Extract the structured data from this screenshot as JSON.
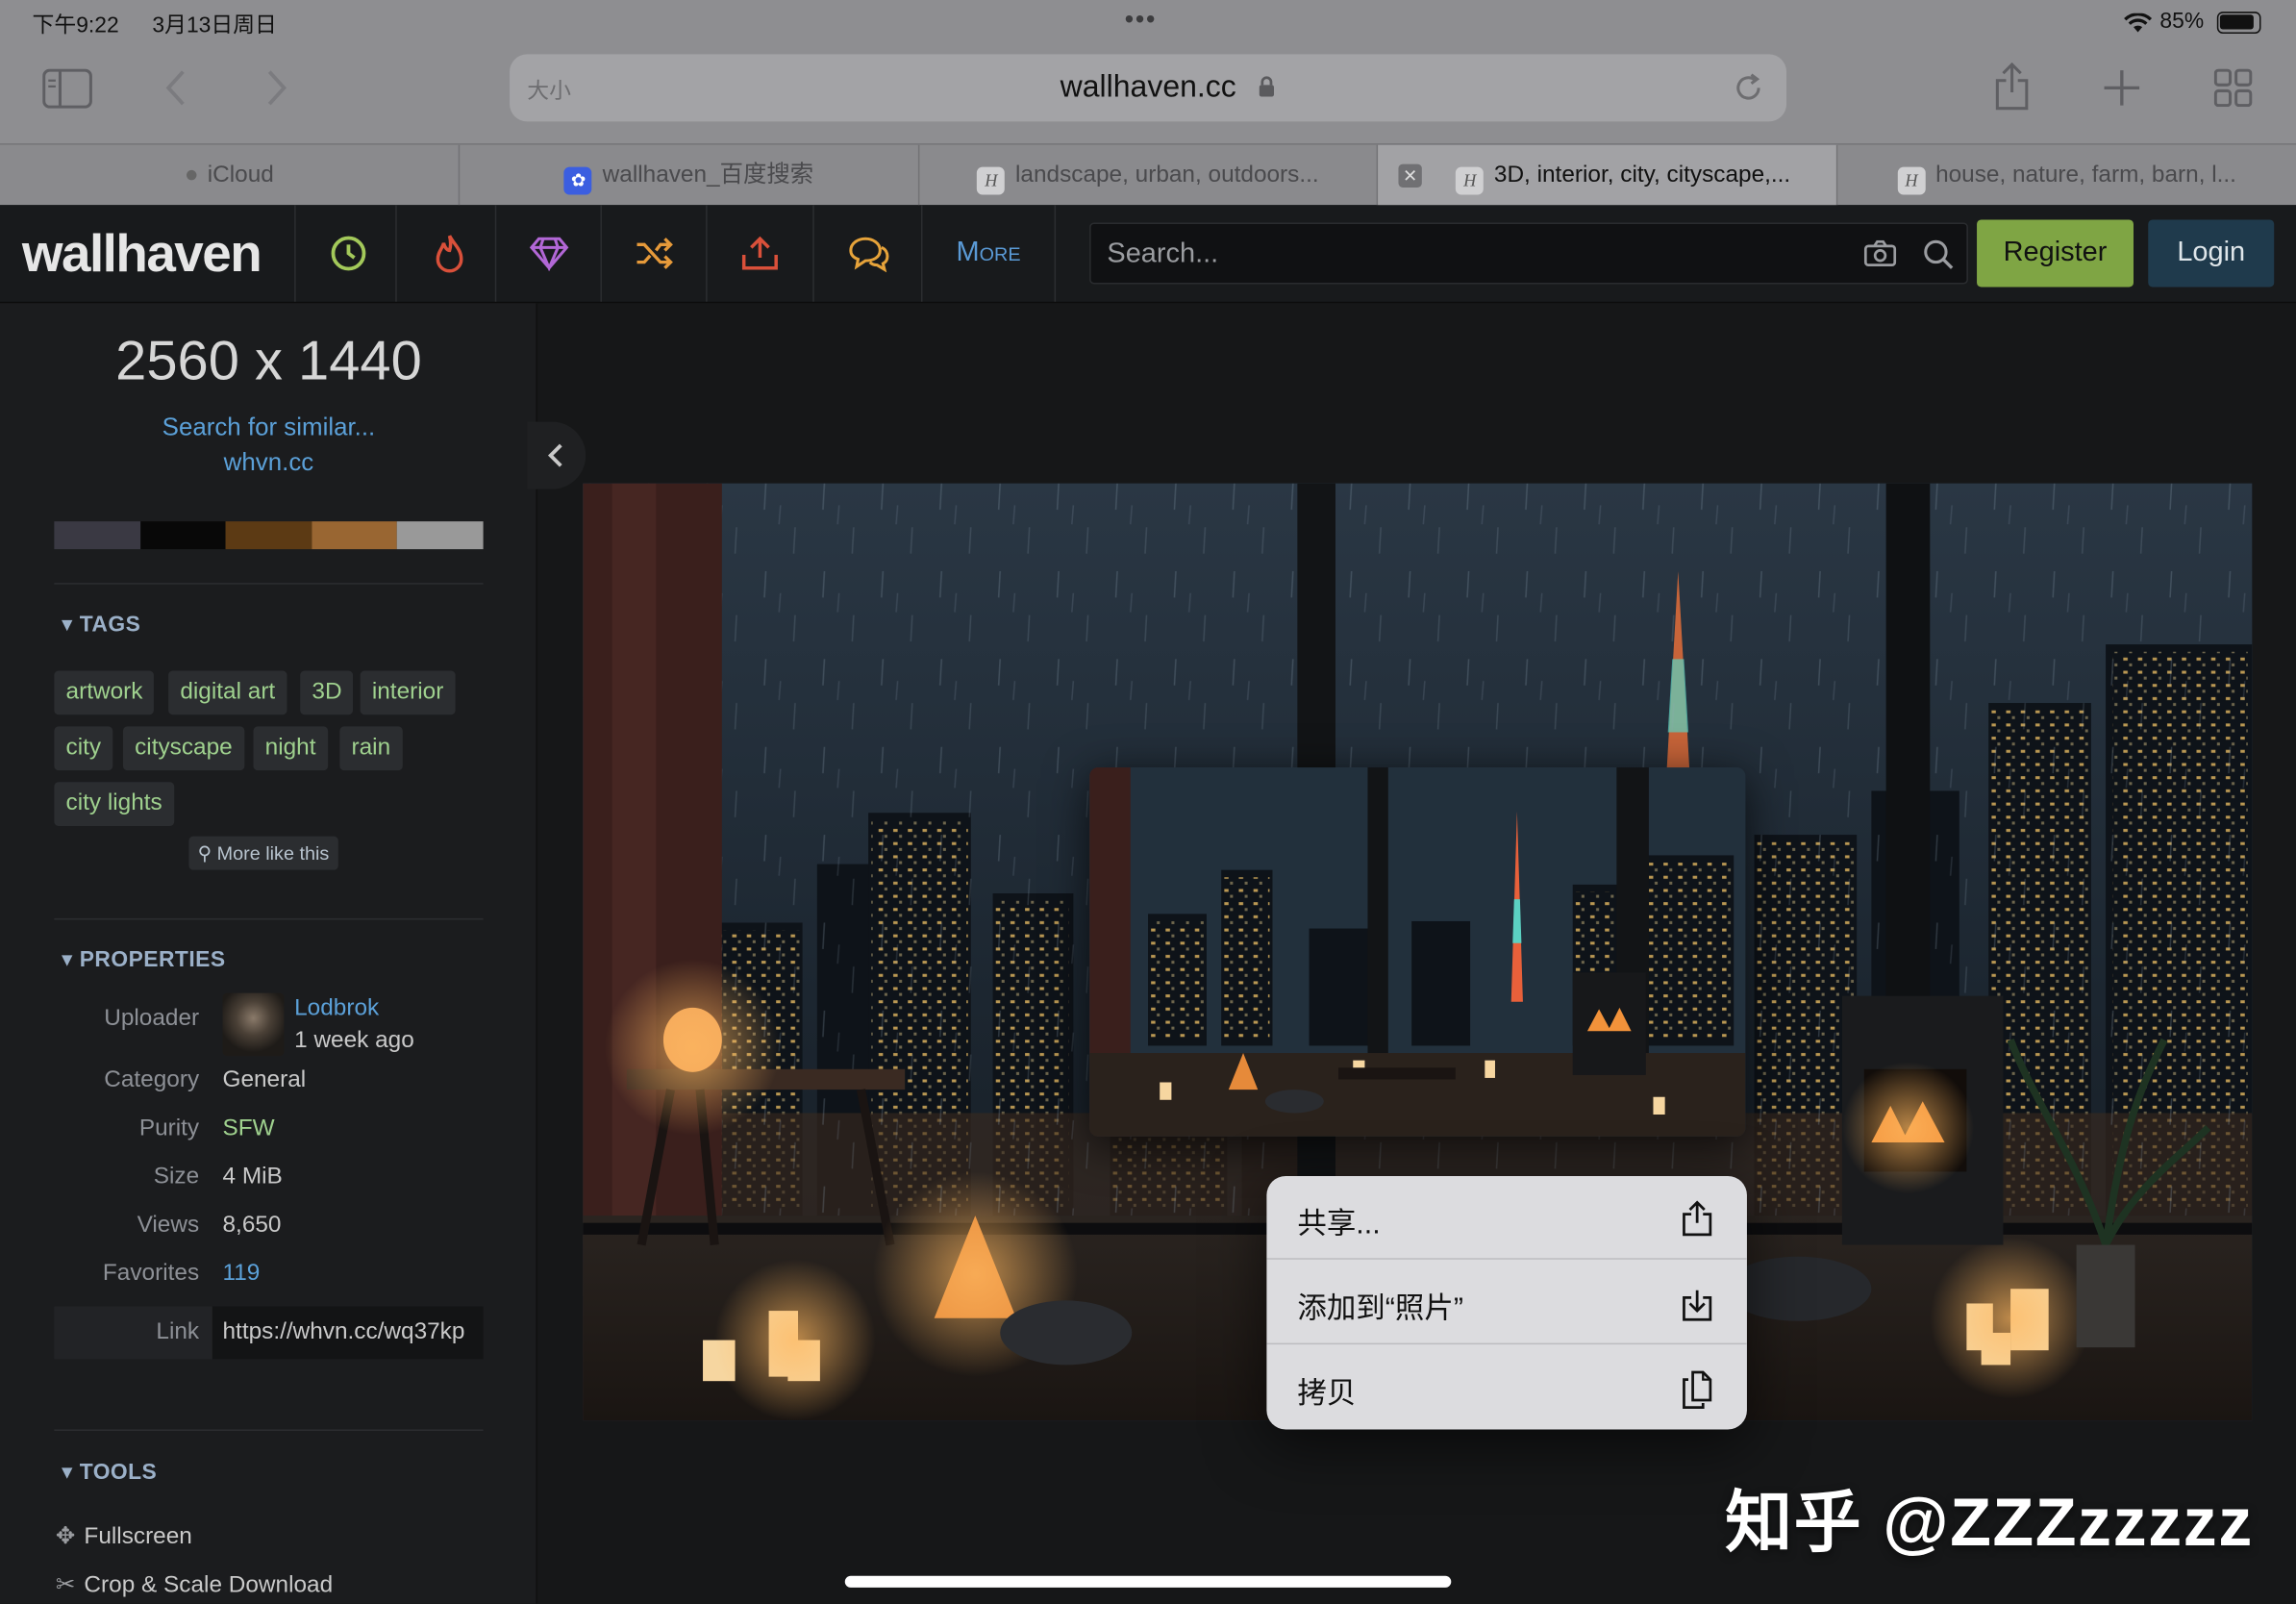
{
  "status": {
    "time": "下午9:22",
    "date": "3月13日周日",
    "battery": "85%",
    "dots": "•••"
  },
  "safari": {
    "url": "wallhaven.cc",
    "text_size": "大小"
  },
  "tabs": [
    {
      "label": "iCloud"
    },
    {
      "label": "wallhaven_百度搜索"
    },
    {
      "label": "landscape, urban, outdoors..."
    },
    {
      "label": "3D, interior, city, cityscape,..."
    },
    {
      "label": "house, nature, farm, barn, l..."
    }
  ],
  "header": {
    "logo": "wallhaven",
    "more_label": "More",
    "search_placeholder": "Search...",
    "register": "Register",
    "login": "Login",
    "colors": {
      "register_bg": "#7fa544",
      "login_bg": "#1f3a4c",
      "latest": "#a3c95a",
      "hot": "#d9503a",
      "toplist": "#b267d6",
      "random": "#e69a3a",
      "upload": "#d9503a",
      "forums": "#e6a33a"
    }
  },
  "sidebar": {
    "resolution": "2560 x 1440",
    "search_similar": "Search for similar...",
    "short_domain": "whvn.cc",
    "palette": [
      "#3a3943",
      "#080808",
      "#5c3a14",
      "#996632",
      "#999999"
    ],
    "tags_heading": "TAGS",
    "tags": [
      "artwork",
      "digital art",
      "3D",
      "interior",
      "city",
      "cityscape",
      "night",
      "rain",
      "city lights"
    ],
    "more_like_this": "More like this",
    "properties_heading": "PROPERTIES",
    "properties": {
      "uploader_label": "Uploader",
      "uploader": "Lodbrok",
      "uploaded": "1 week ago",
      "category_label": "Category",
      "category": "General",
      "purity_label": "Purity",
      "purity": "SFW",
      "size_label": "Size",
      "size": "4 MiB",
      "views_label": "Views",
      "views": "8,650",
      "favorites_label": "Favorites",
      "favorites": "119",
      "link_label": "Link",
      "link": "https://whvn.cc/wq37kp"
    },
    "tools_heading": "TOOLS",
    "tools": [
      "Fullscreen",
      "Crop & Scale Download"
    ]
  },
  "context_menu": {
    "items": [
      {
        "label": "共享...",
        "icon": "share-icon"
      },
      {
        "label": "添加到“照片”",
        "icon": "save-to-photos-icon"
      },
      {
        "label": "拷贝",
        "icon": "copy-icon"
      }
    ]
  },
  "watermark": "知乎 @ZZZzzzzz"
}
